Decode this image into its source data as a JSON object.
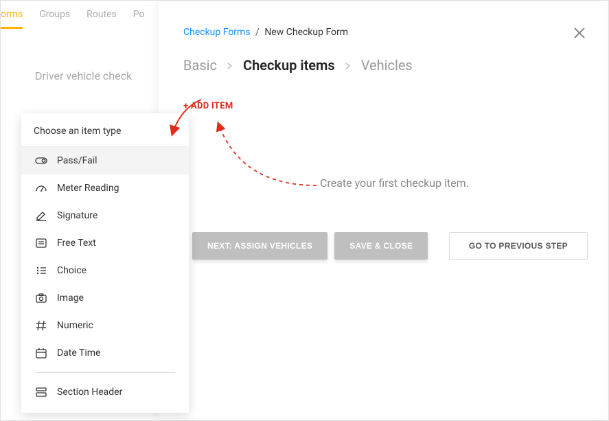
{
  "bg_tabs": {
    "forms": "orms",
    "groups": "Groups",
    "routes": "Routes",
    "po": "Po"
  },
  "bg_card_text": "Driver vehicle check",
  "breadcrumb": {
    "link": "Checkup Forms",
    "sep": "/",
    "current": "New Checkup Form"
  },
  "wizard": {
    "basic": "Basic",
    "items": "Checkup items",
    "vehicles": "Vehicles"
  },
  "add_item_label": "+ ADD ITEM",
  "hint_text": "Create your first checkup item.",
  "buttons": {
    "next": "NEXT: ASSIGN VEHICLES",
    "save": "SAVE & CLOSE",
    "prev": "GO TO PREVIOUS STEP"
  },
  "popup": {
    "header": "Choose an item type",
    "items": [
      {
        "icon": "toggle",
        "label": "Pass/Fail"
      },
      {
        "icon": "gauge",
        "label": "Meter Reading"
      },
      {
        "icon": "signature",
        "label": "Signature"
      },
      {
        "icon": "text",
        "label": "Free Text"
      },
      {
        "icon": "choice",
        "label": "Choice"
      },
      {
        "icon": "image",
        "label": "Image"
      },
      {
        "icon": "numeric",
        "label": "Numeric"
      },
      {
        "icon": "datetime",
        "label": "Date Time"
      },
      {
        "icon": "section",
        "label": "Section Header"
      }
    ]
  }
}
